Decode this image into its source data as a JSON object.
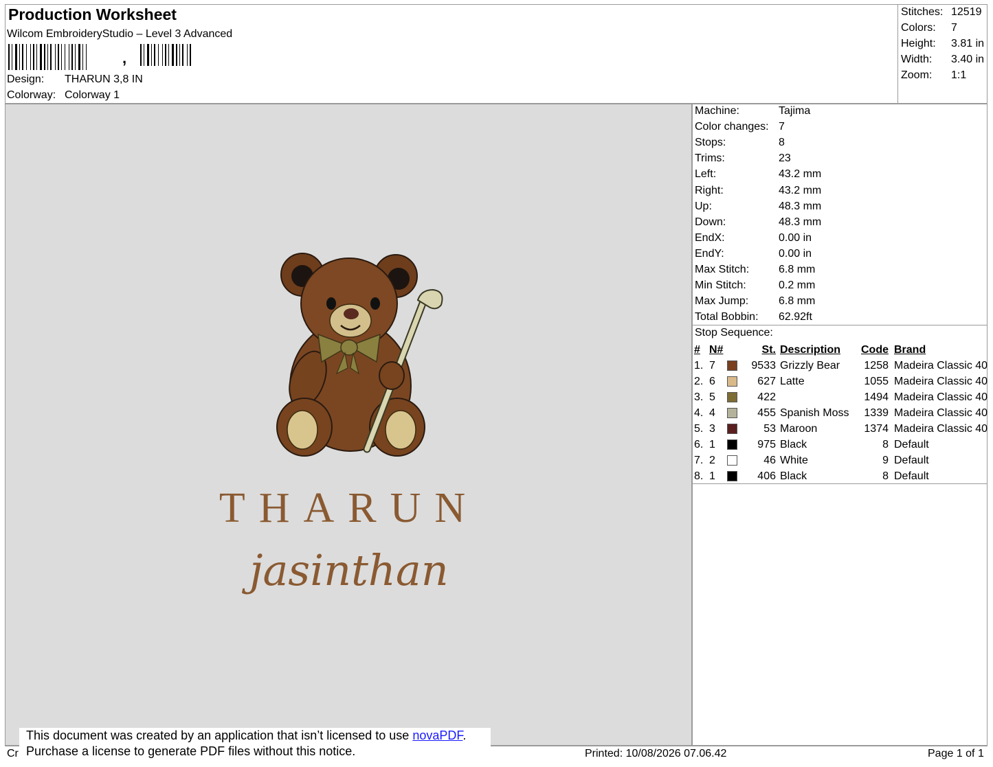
{
  "header": {
    "title": "Production Worksheet",
    "subtitle": "Wilcom EmbroideryStudio – Level 3 Advanced",
    "barcode_text": ",",
    "design_label": "Design:",
    "design_value": "THARUN 3,8 IN",
    "colorway_label": "Colorway:",
    "colorway_value": "Colorway 1"
  },
  "summary": [
    {
      "label": "Stitches:",
      "value": "12519"
    },
    {
      "label": "Colors:",
      "value": "7"
    },
    {
      "label": "Height:",
      "value": "3.81 in"
    },
    {
      "label": "Width:",
      "value": "3.40 in"
    },
    {
      "label": "Zoom:",
      "value": "1:1"
    }
  ],
  "machine_info": [
    {
      "label": "Machine:",
      "value": "Tajima"
    },
    {
      "label": "Color changes:",
      "value": "7"
    },
    {
      "label": "Stops:",
      "value": "8"
    },
    {
      "label": "Trims:",
      "value": "23"
    },
    {
      "label": "Left:",
      "value": "43.2 mm"
    },
    {
      "label": "Right:",
      "value": "43.2 mm"
    },
    {
      "label": "Up:",
      "value": "48.3 mm"
    },
    {
      "label": "Down:",
      "value": "48.3 mm"
    },
    {
      "label": "EndX:",
      "value": "0.00 in"
    },
    {
      "label": "EndY:",
      "value": "0.00 in"
    },
    {
      "label": "Max Stitch:",
      "value": "6.8 mm"
    },
    {
      "label": "Min Stitch:",
      "value": "0.2 mm"
    },
    {
      "label": "Max Jump:",
      "value": "6.8 mm"
    },
    {
      "label": "Total Bobbin:",
      "value": "62.92ft"
    }
  ],
  "stop_sequence": {
    "title": "Stop Sequence:",
    "columns": [
      "#",
      "N#",
      "St.",
      "Description",
      "Code",
      "Brand"
    ],
    "rows": [
      {
        "num": "1.",
        "n": "7",
        "color": "#7a3f1f",
        "st": "9533",
        "desc": "Grizzly Bear",
        "code": "1258",
        "brand": "Madeira Classic 40"
      },
      {
        "num": "2.",
        "n": "6",
        "color": "#d9b98a",
        "st": "627",
        "desc": "Latte",
        "code": "1055",
        "brand": "Madeira Classic 40"
      },
      {
        "num": "3.",
        "n": "5",
        "color": "#7d6d35",
        "st": "422",
        "desc": "",
        "code": "1494",
        "brand": "Madeira Classic 40"
      },
      {
        "num": "4.",
        "n": "4",
        "color": "#b4b29a",
        "st": "455",
        "desc": "Spanish Moss",
        "code": "1339",
        "brand": "Madeira Classic 40"
      },
      {
        "num": "5.",
        "n": "3",
        "color": "#5a1f1f",
        "st": "53",
        "desc": "Maroon",
        "code": "1374",
        "brand": "Madeira Classic 40"
      },
      {
        "num": "6.",
        "n": "1",
        "color": "#000000",
        "st": "975",
        "desc": "Black",
        "code": "8",
        "brand": "Default"
      },
      {
        "num": "7.",
        "n": "2",
        "color": "#ffffff",
        "st": "46",
        "desc": "White",
        "code": "9",
        "brand": "Default"
      },
      {
        "num": "8.",
        "n": "1",
        "color": "#000000",
        "st": "406",
        "desc": "Black",
        "code": "8",
        "brand": "Default"
      }
    ]
  },
  "design_preview": {
    "line1": "THARUN",
    "line2": "jasinthan",
    "thread_color": "#8a5a32"
  },
  "footer": {
    "created_prefix": "Cr",
    "notice_line1": "This document was created by an application that isn’t licensed to use ",
    "notice_link": "novaPDF",
    "notice_line1_end": ".",
    "notice_line2": "Purchase a license to generate PDF files without this notice.",
    "printed": "Printed: 10/08/2026 07.06.42",
    "page": "Page 1 of 1"
  }
}
